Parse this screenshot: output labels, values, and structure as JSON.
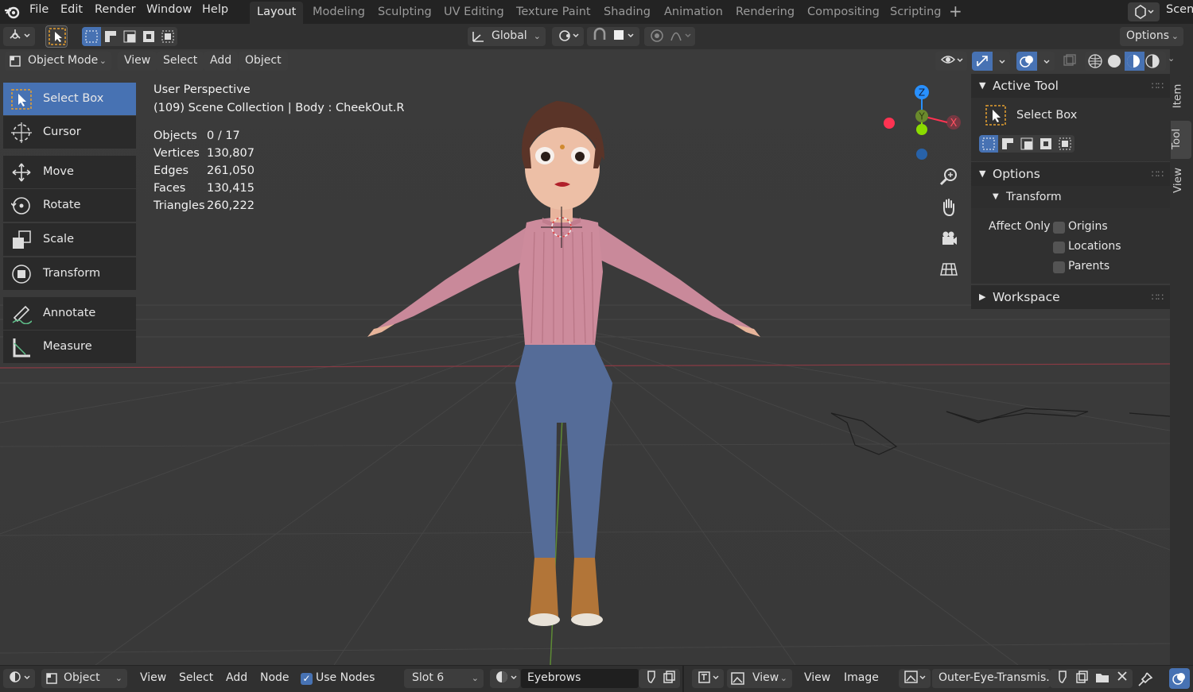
{
  "app": {
    "title": "Blender"
  },
  "top_menu": [
    "File",
    "Edit",
    "Render",
    "Window",
    "Help"
  ],
  "workspace_tabs": [
    {
      "label": "Layout",
      "active": true
    },
    {
      "label": "Modeling"
    },
    {
      "label": "Sculpting"
    },
    {
      "label": "UV Editing"
    },
    {
      "label": "Texture Paint"
    },
    {
      "label": "Shading"
    },
    {
      "label": "Animation"
    },
    {
      "label": "Rendering"
    },
    {
      "label": "Compositing"
    },
    {
      "label": "Scripting"
    }
  ],
  "scene_label": "Scen",
  "tool_header": {
    "orientation": "Global",
    "options": "Options"
  },
  "viewport_header": {
    "mode": "Object Mode",
    "menus": [
      "View",
      "Select",
      "Add",
      "Object"
    ]
  },
  "toolshelf": [
    {
      "label": "Select Box",
      "selected": true,
      "icon": "select-box-icon"
    },
    {
      "label": "Cursor",
      "icon": "cursor-icon"
    },
    {
      "label": "Move",
      "icon": "move-icon"
    },
    {
      "label": "Rotate",
      "icon": "rotate-icon"
    },
    {
      "label": "Scale",
      "icon": "scale-icon"
    },
    {
      "label": "Transform",
      "icon": "transform-icon"
    },
    {
      "label": "Annotate",
      "icon": "annotate-icon"
    },
    {
      "label": "Measure",
      "icon": "measure-icon"
    }
  ],
  "overlay": {
    "perspective": "User Perspective",
    "collection": "(109) Scene Collection | Body : CheekOut.R",
    "stats": [
      {
        "label": "Objects",
        "value": "0 / 17"
      },
      {
        "label": "Vertices",
        "value": "130,807"
      },
      {
        "label": "Edges",
        "value": "261,050"
      },
      {
        "label": "Faces",
        "value": "130,415"
      },
      {
        "label": "Triangles",
        "value": "260,222"
      }
    ]
  },
  "gizmo": {
    "x": "X",
    "y": "Y",
    "z": "Z"
  },
  "npanel": {
    "active_tool_title": "Active Tool",
    "active_tool_name": "Select Box",
    "options_title": "Options",
    "transform_title": "Transform",
    "affect_only": "Affect Only",
    "checks": [
      {
        "label": "Origins",
        "checked": false
      },
      {
        "label": "Locations",
        "checked": false
      },
      {
        "label": "Parents",
        "checked": false
      }
    ],
    "workspace_title": "Workspace",
    "tabs": [
      "Item",
      "Tool",
      "View"
    ]
  },
  "bottom": {
    "object": "Object",
    "menus": [
      "View",
      "Select",
      "Add",
      "Node"
    ],
    "use_nodes": "Use Nodes",
    "slot": "Slot 6",
    "material": "Eyebrows",
    "view_dropdown": "View",
    "menus2": [
      "View",
      "Image"
    ],
    "image": "Outer-Eye-Transmis..."
  },
  "colors": {
    "accent": "#4772b3",
    "axis_x": "#ff3352",
    "axis_y": "#8bdc00",
    "axis_z": "#2890ff"
  }
}
